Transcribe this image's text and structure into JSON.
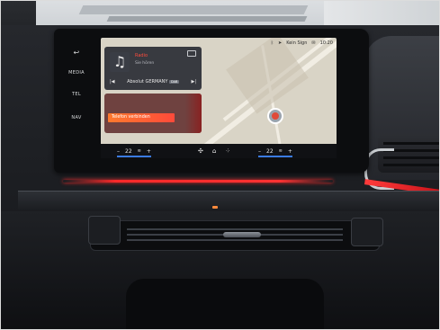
{
  "side_menu": {
    "items": [
      "MEDIA",
      "TEL",
      "NAV"
    ],
    "back_icon": "back-arrow-icon"
  },
  "status_bar": {
    "bluetooth_icon": "bluetooth-icon",
    "signal_text": "Kein Sign",
    "clock": "10:20"
  },
  "media": {
    "title": "Radio",
    "subtitle": "Sie hören",
    "station": "Absolut GERMANY",
    "station_tag": "DAB",
    "icon": "music-note-icon",
    "accent_color": "#ff4c3c"
  },
  "phone": {
    "connect_label": "Telefon verbinden",
    "accent_color": "#ff5a34"
  },
  "climate": {
    "left_temp": "22",
    "right_temp": "22",
    "minus": "–",
    "plus": "+",
    "heat_color": "#e0453a",
    "cool_color": "#3a7ae0"
  },
  "ambient_color": "#ff2a2a"
}
